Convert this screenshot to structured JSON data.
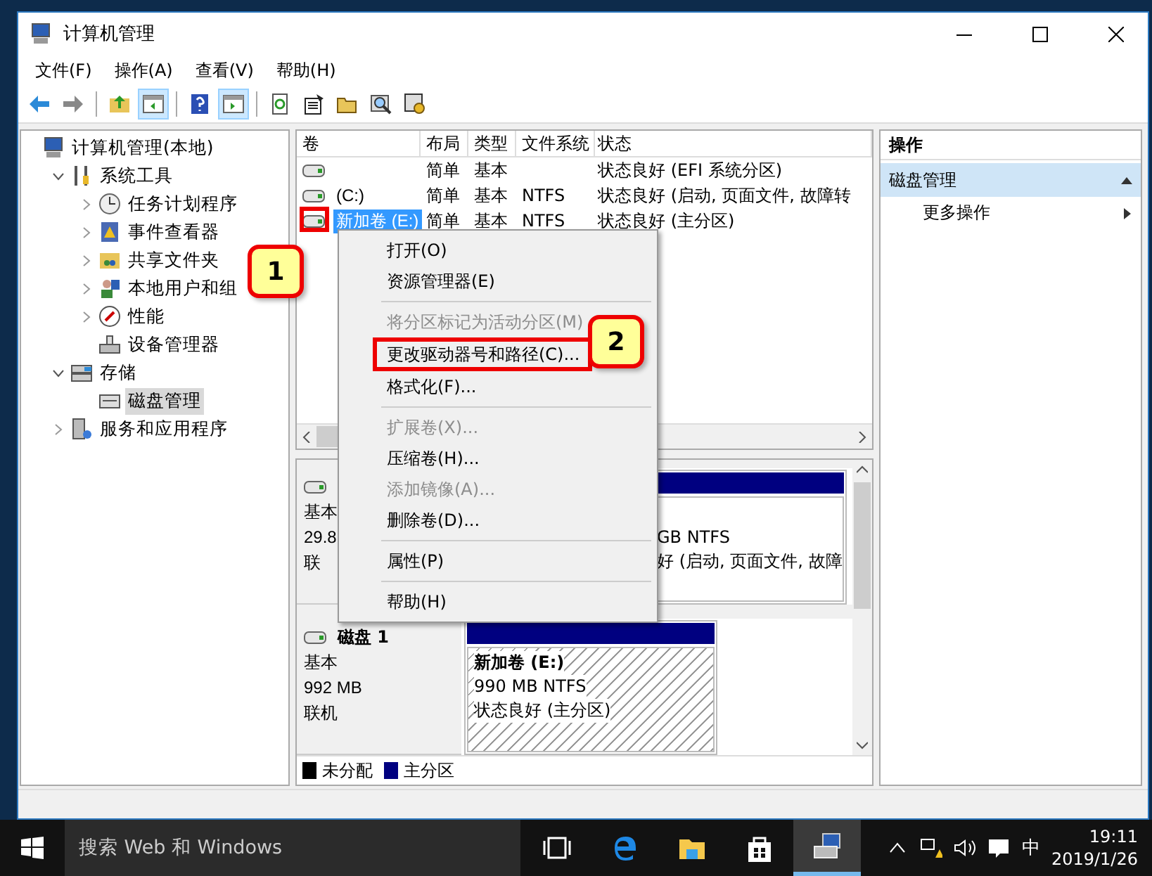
{
  "window": {
    "title": "计算机管理"
  },
  "menu_bar": [
    "文件(F)",
    "操作(A)",
    "查看(V)",
    "帮助(H)"
  ],
  "toolbar": [
    {
      "kind": "button",
      "pressed": false
    },
    {
      "kind": "button",
      "pressed": false
    },
    {
      "kind": "separator"
    },
    {
      "kind": "button",
      "pressed": false
    },
    {
      "kind": "button",
      "pressed": true
    },
    {
      "kind": "separator"
    },
    {
      "kind": "button",
      "pressed": false
    },
    {
      "kind": "button",
      "pressed": true
    },
    {
      "kind": "separator"
    },
    {
      "kind": "button",
      "pressed": false
    },
    {
      "kind": "button",
      "pressed": false
    },
    {
      "kind": "button",
      "pressed": false
    },
    {
      "kind": "button",
      "pressed": false
    },
    {
      "kind": "button",
      "pressed": false
    }
  ],
  "tree": [
    {
      "label": "计算机管理(本地)",
      "kind": "plain",
      "selected": false,
      "children": [
        {
          "label": "系统工具",
          "kind": "node",
          "expanded": true,
          "selected": false,
          "children": [
            {
              "label": "任务计划程序",
              "kind": "node",
              "expanded": false,
              "selected": false
            },
            {
              "label": "事件查看器",
              "kind": "node",
              "expanded": false,
              "selected": false
            },
            {
              "label": "共享文件夹",
              "kind": "node",
              "expanded": false,
              "selected": false
            },
            {
              "label": "本地用户和组",
              "kind": "node",
              "expanded": false,
              "selected": false
            },
            {
              "label": "性能",
              "kind": "node",
              "expanded": false,
              "selected": false
            },
            {
              "label": "设备管理器",
              "kind": "plain",
              "selected": false
            }
          ]
        },
        {
          "label": "存储",
          "kind": "node",
          "expanded": true,
          "selected": false,
          "children": [
            {
              "label": "磁盘管理",
              "kind": "plain",
              "selected": true
            }
          ]
        },
        {
          "label": "服务和应用程序",
          "kind": "node",
          "expanded": false,
          "selected": false
        }
      ]
    }
  ],
  "volume_list": {
    "columns": [
      "卷",
      "布局",
      "类型",
      "文件系统",
      "状态"
    ],
    "rows": [
      {
        "layout": "简单",
        "type": "基本",
        "status": "状态良好 (EFI 系统分区)",
        "selected": false,
        "annotated": false
      },
      {
        "volume": "(C:)",
        "layout": "简单",
        "type": "基本",
        "file_system": "NTFS",
        "status": "状态良好 (启动, 页面文件, 故障转",
        "selected": false,
        "annotated": false
      },
      {
        "volume": "新加卷 (E:)",
        "layout": "简单",
        "type": "基本",
        "file_system": "NTFS",
        "status": "状态良好 (主分区)",
        "selected": true,
        "annotated": true
      }
    ]
  },
  "disks": [
    {
      "labels": [
        "基本",
        "29.8",
        "联"
      ],
      "partitions": [
        {
          "lines": [
            "GB NTFS",
            "好 (启动, 页面文件, 故障"
          ],
          "selected": false
        }
      ]
    },
    {
      "name": "磁盘 1",
      "labels": [
        "基本",
        "992 MB",
        "联机"
      ],
      "partitions": [
        {
          "name": "新加卷 (E:)",
          "lines": [
            "990 MB NTFS",
            "状态良好 (主分区)"
          ],
          "selected": true
        }
      ]
    }
  ],
  "legend": [
    {
      "label": "未分配",
      "color": "#000000"
    },
    {
      "label": "主分区",
      "color": "#000080"
    }
  ],
  "actions": {
    "title": "操作",
    "groups": [
      {
        "label": "磁盘管理",
        "expanded": true,
        "items": [
          "更多操作"
        ]
      }
    ]
  },
  "context_menu": [
    {
      "kind": "item",
      "label": "打开(O)",
      "disabled": false,
      "annotated": false
    },
    {
      "kind": "item",
      "label": "资源管理器(E)",
      "disabled": false,
      "annotated": false
    },
    {
      "kind": "separator"
    },
    {
      "kind": "item",
      "label": "将分区标记为活动分区(M)",
      "disabled": true,
      "annotated": false
    },
    {
      "kind": "item",
      "label": "更改驱动器号和路径(C)...",
      "disabled": false,
      "annotated": true
    },
    {
      "kind": "item",
      "label": "格式化(F)...",
      "disabled": false,
      "annotated": false
    },
    {
      "kind": "separator"
    },
    {
      "kind": "item",
      "label": "扩展卷(X)...",
      "disabled": true,
      "annotated": false
    },
    {
      "kind": "item",
      "label": "压缩卷(H)...",
      "disabled": false,
      "annotated": false
    },
    {
      "kind": "item",
      "label": "添加镜像(A)...",
      "disabled": true,
      "annotated": false
    },
    {
      "kind": "item",
      "label": "删除卷(D)...",
      "disabled": false,
      "annotated": false
    },
    {
      "kind": "separator"
    },
    {
      "kind": "item",
      "label": "属性(P)",
      "disabled": false,
      "annotated": false
    },
    {
      "kind": "separator"
    },
    {
      "kind": "item",
      "label": "帮助(H)",
      "disabled": false,
      "annotated": false
    }
  ],
  "callouts": [
    {
      "label": "1"
    },
    {
      "label": "2"
    }
  ],
  "taskbar": {
    "search_placeholder": "搜索 Web 和 Windows",
    "apps": [
      {
        "selected": false
      },
      {
        "selected": false
      },
      {
        "selected": false
      },
      {
        "selected": false
      },
      {
        "selected": true
      }
    ],
    "input_method": "中",
    "time": "19:11",
    "date": "2019/1/26"
  }
}
